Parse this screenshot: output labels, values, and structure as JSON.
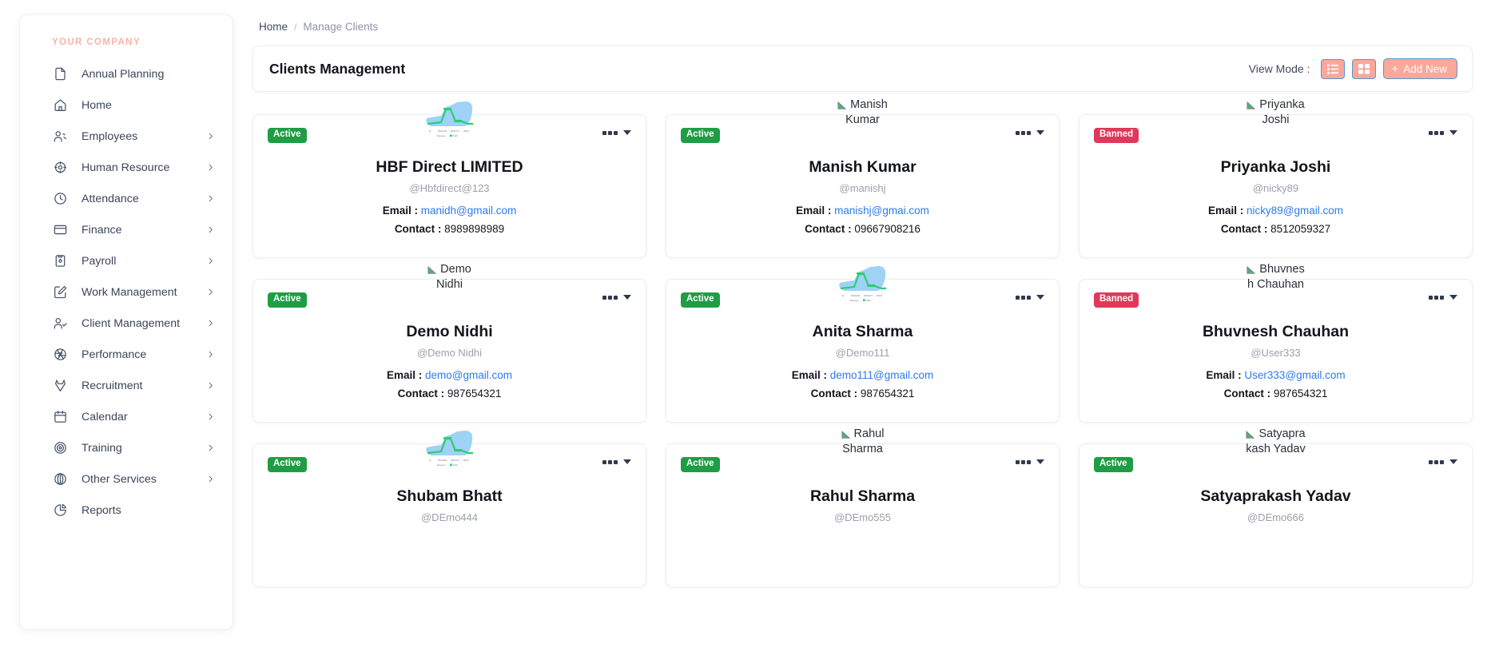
{
  "sidebar": {
    "brand": "YOUR COMPANY",
    "items": [
      {
        "label": "Annual Planning",
        "icon": "file-icon",
        "chevron": false
      },
      {
        "label": "Home",
        "icon": "home-icon",
        "chevron": false
      },
      {
        "label": "Employees",
        "icon": "users-icon",
        "chevron": true
      },
      {
        "label": "Human Resource",
        "icon": "target-crosshair-icon",
        "chevron": true
      },
      {
        "label": "Attendance",
        "icon": "clock-icon",
        "chevron": true
      },
      {
        "label": "Finance",
        "icon": "credit-card-icon",
        "chevron": true
      },
      {
        "label": "Payroll",
        "icon": "clipboard-icon",
        "chevron": true
      },
      {
        "label": "Work Management",
        "icon": "edit-square-icon",
        "chevron": true
      },
      {
        "label": "Client Management",
        "icon": "user-check-icon",
        "chevron": true
      },
      {
        "label": "Performance",
        "icon": "aperture-icon",
        "chevron": true
      },
      {
        "label": "Recruitment",
        "icon": "gitlab-icon",
        "chevron": true
      },
      {
        "label": "Calendar",
        "icon": "calendar-icon",
        "chevron": true
      },
      {
        "label": "Training",
        "icon": "target-icon",
        "chevron": true
      },
      {
        "label": "Other Services",
        "icon": "globe-icon",
        "chevron": true
      },
      {
        "label": "Reports",
        "icon": "pie-chart-icon",
        "chevron": false
      }
    ]
  },
  "breadcrumb": {
    "home": "Home",
    "separator": "/",
    "current": "Manage Clients"
  },
  "header": {
    "title": "Clients Management",
    "view_mode_label": "View Mode :",
    "list_view_icon": "list-view-icon",
    "grid_view_icon": "grid-view-icon",
    "add_new_label": "Add New",
    "add_new_plus": "+"
  },
  "colors": {
    "accent": "#fba79a",
    "accent_border": "#4f9bd6",
    "active": "#1f9d45",
    "banned": "#e0385a",
    "link": "#2f79f0",
    "brand_text": "#f9b4a8"
  },
  "labels": {
    "email": "Email :",
    "contact": "Contact :"
  },
  "cards": [
    {
      "status": "Active",
      "status_type": "active",
      "avatar_type": "chart",
      "avatar_alt": "HBF Direct LIMITED",
      "name": "HBF Direct LIMITED",
      "handle": "@Hbfdirect@123",
      "email": "manidh@gmail.com",
      "contact": "8989898989"
    },
    {
      "status": "Active",
      "status_type": "active",
      "avatar_type": "broken",
      "avatar_alt": "Manish Kumar",
      "alt_line1": "Manish",
      "alt_line2": "Kumar",
      "name": "Manish Kumar",
      "handle": "@manishj",
      "email": "manishj@gmai.com",
      "contact": "09667908216"
    },
    {
      "status": "Banned",
      "status_type": "banned",
      "avatar_type": "broken",
      "avatar_alt": "Priyanka Joshi",
      "alt_line1": "Priyanka",
      "alt_line2": "Joshi",
      "name": "Priyanka Joshi",
      "handle": "@nicky89",
      "email": "nicky89@gmail.com",
      "contact": "8512059327"
    },
    {
      "status": "Active",
      "status_type": "active",
      "avatar_type": "broken",
      "avatar_alt": "Demo Nidhi",
      "alt_line1": "Demo",
      "alt_line2": "Nidhi",
      "name": "Demo Nidhi",
      "handle": "@Demo Nidhi",
      "email": "demo@gmail.com",
      "contact": "987654321"
    },
    {
      "status": "Active",
      "status_type": "active",
      "avatar_type": "chart",
      "avatar_alt": "Anita Sharma",
      "name": "Anita Sharma",
      "handle": "@Demo111",
      "email": "demo111@gmail.com",
      "contact": "987654321"
    },
    {
      "status": "Banned",
      "status_type": "banned",
      "avatar_type": "broken",
      "avatar_alt": "Bhuvnesh Chauhan",
      "alt_line1": "Bhuvnes",
      "alt_line2": "h Chauhan",
      "name": "Bhuvnesh Chauhan",
      "handle": "@User333",
      "email": "User333@gmail.com",
      "contact": "987654321"
    },
    {
      "status": "Active",
      "status_type": "active",
      "avatar_type": "chart",
      "avatar_alt": "Shubam Bhatt",
      "name": "Shubam Bhatt",
      "handle": "@DEmo444",
      "email": "",
      "contact": ""
    },
    {
      "status": "Active",
      "status_type": "active",
      "avatar_type": "broken",
      "avatar_alt": "Rahul Sharma",
      "alt_line1": "Rahul",
      "alt_line2": "Sharma",
      "name": "Rahul Sharma",
      "handle": "@DEmo555",
      "email": "",
      "contact": ""
    },
    {
      "status": "Active",
      "status_type": "active",
      "avatar_type": "broken",
      "avatar_alt": "Satyaprakash Yadav",
      "alt_line1": "Satyapra",
      "alt_line2": "kash Yadav",
      "name": "Satyaprakash Yadav",
      "handle": "@DEmo666",
      "email": "",
      "contact": ""
    }
  ]
}
